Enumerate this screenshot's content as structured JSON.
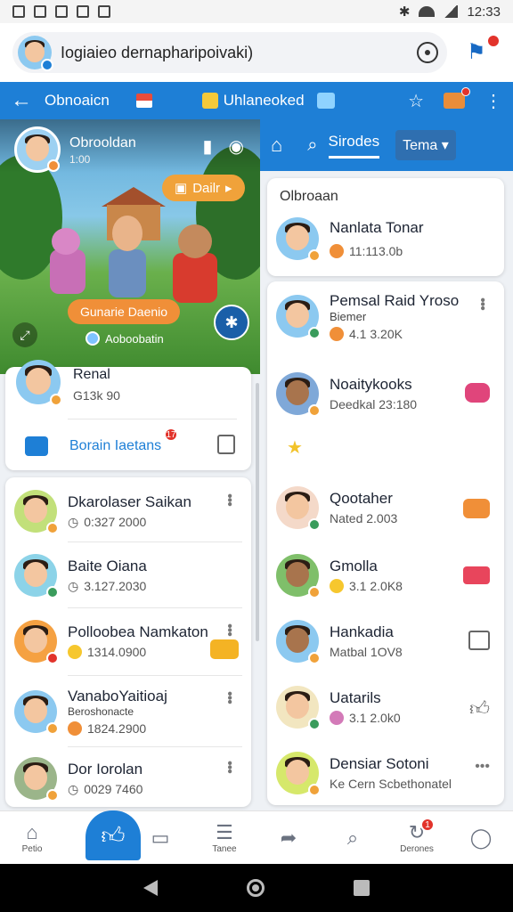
{
  "status_bar": {
    "time": "12:33"
  },
  "search": {
    "text": "Iogiaieo dernapharipoivaki)"
  },
  "appbar": {
    "title": "Obnoaicn",
    "subtitle": "Uhlaneoked"
  },
  "hero": {
    "name": "Obrooldan",
    "sub": "1:00",
    "pill_top": "Dailr",
    "pill_mid": "Gunarie Daenio",
    "footer": "Aoboobatin"
  },
  "right_nav": {
    "tab": "Sirodes",
    "dropdown": "Tema"
  },
  "profile_card": {
    "name": "Renal",
    "sub": "G13k 90",
    "link": "Borain Iaetans",
    "badge": "17"
  },
  "featured": {
    "header": "Olbroaan",
    "name": "Nanlata Tonar",
    "meta": "11:113.0b"
  },
  "left_list": [
    {
      "name": "Dkarolaser Saikan",
      "meta": "0:327 2000"
    },
    {
      "name": "Baite Oiana",
      "meta": "3.127.2030"
    },
    {
      "name": "Polloobea Namkaton",
      "meta": "1314.0900"
    },
    {
      "name": "VanaboYaitioaj",
      "sub": "Beroshonacte",
      "meta": "1824.2900"
    },
    {
      "name": "Dor Iorolan",
      "meta": "0029 7460"
    }
  ],
  "right_list": [
    {
      "name": "Pemsal Raid Yroso",
      "sub": "Biemer",
      "meta": "4.1 3.20K"
    },
    {
      "name": "Noaitykooks",
      "meta": "Deedkal 23:180"
    },
    {
      "name": "Qootaher",
      "meta": "Nated 2.003"
    },
    {
      "name": "Gmolla",
      "meta": "3.1 2.0K8"
    },
    {
      "name": "Hankadia",
      "meta": "Matbal 1OV8"
    },
    {
      "name": "Uatarils",
      "meta": "3.1 2.0k0"
    },
    {
      "name": "Densiar Sotoni",
      "meta": "Ke Cern Scbethonatel"
    }
  ],
  "bottom_nav": [
    {
      "label": "Petio",
      "icon": "home-icon"
    },
    {
      "label": "",
      "icon": "thumbs-up-icon"
    },
    {
      "label": "",
      "icon": "message-icon"
    },
    {
      "label": "Tanee",
      "icon": "chat-icon"
    },
    {
      "label": "",
      "icon": "share-icon"
    },
    {
      "label": "",
      "icon": "search-icon"
    },
    {
      "label": "Derones",
      "icon": "refresh-icon",
      "badge": "1"
    },
    {
      "label": "",
      "icon": "profile-icon"
    }
  ],
  "colors": {
    "primary": "#1e7fd6",
    "accent": "#f0a23a",
    "badge": "#e2332b"
  }
}
